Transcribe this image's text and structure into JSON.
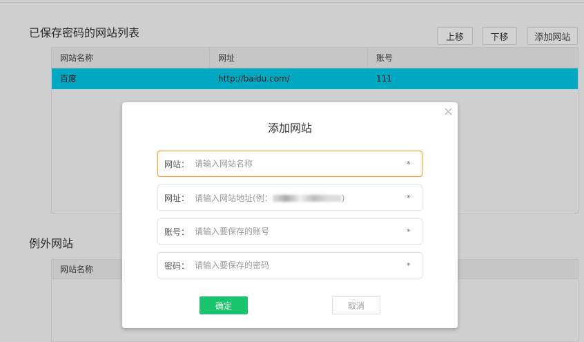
{
  "saved": {
    "title": "已保存密码的网站列表",
    "buttons": {
      "up": "上移",
      "down": "下移",
      "add": "添加网站"
    },
    "columns": [
      "网站名称",
      "网址",
      "账号"
    ],
    "rows": [
      {
        "name": "百度",
        "url": "http://baidu.com/",
        "account": "111"
      }
    ],
    "selected_color": "#00a8c2"
  },
  "exceptions": {
    "title": "例外网站",
    "columns": [
      "网站名称"
    ]
  },
  "dialog": {
    "title": "添加网站",
    "close": "×",
    "fields": [
      {
        "label": "网站：",
        "placeholder": "请输入网站名称",
        "required": "*"
      },
      {
        "label": "网址：",
        "placeholder": "请输入网站地址(例：",
        "placeholder_end": ")",
        "required": "*"
      },
      {
        "label": "账号：",
        "placeholder": "请输入要保存的账号",
        "required": "*"
      },
      {
        "label": "密码：",
        "placeholder": "请输入要保存的密码",
        "required": "*"
      }
    ],
    "ok": "确定",
    "cancel": "取消",
    "ok_color": "#18c46c"
  }
}
